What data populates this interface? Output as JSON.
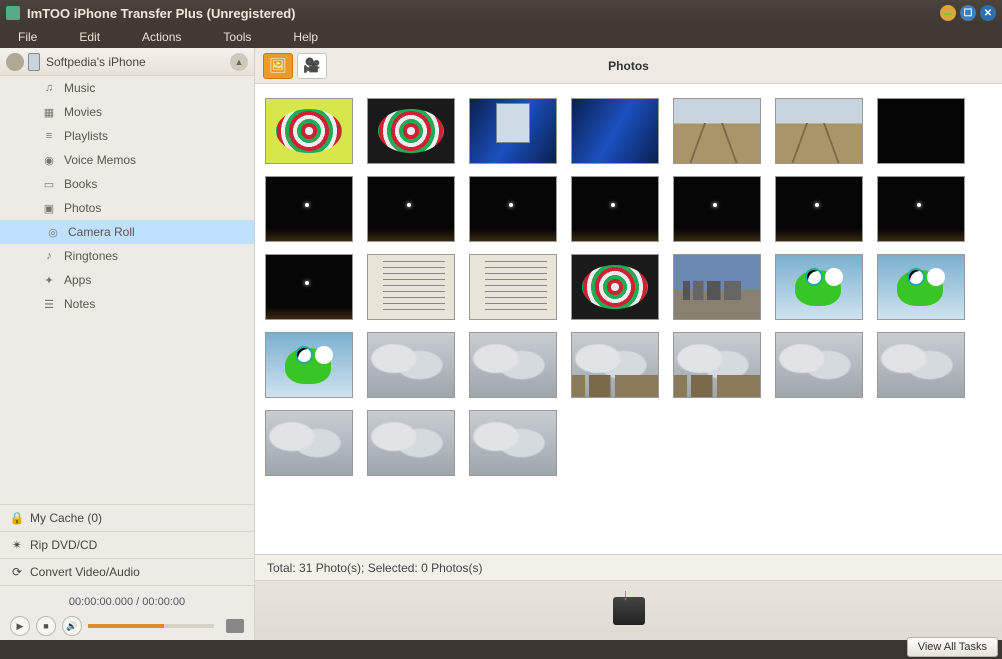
{
  "window": {
    "title": "ImTOO iPhone Transfer Plus (Unregistered)"
  },
  "menu": {
    "file": "File",
    "edit": "Edit",
    "actions": "Actions",
    "tools": "Tools",
    "help": "Help"
  },
  "device": {
    "name": "Softpedia's iPhone"
  },
  "tree": {
    "music": "Music",
    "movies": "Movies",
    "playlists": "Playlists",
    "voice_memos": "Voice Memos",
    "books": "Books",
    "photos": "Photos",
    "camera_roll": "Camera Roll",
    "ringtones": "Ringtones",
    "apps": "Apps",
    "notes": "Notes"
  },
  "side": {
    "my_cache": "My Cache (0)",
    "rip": "Rip DVD/CD",
    "convert": "Convert Video/Audio"
  },
  "player": {
    "time": "00:00:00.000 / 00:00:00"
  },
  "content": {
    "title": "Photos",
    "status": "Total: 31 Photo(s); Selected: 0 Photos(s)"
  },
  "footer": {
    "view_tasks": "View All Tasks"
  }
}
